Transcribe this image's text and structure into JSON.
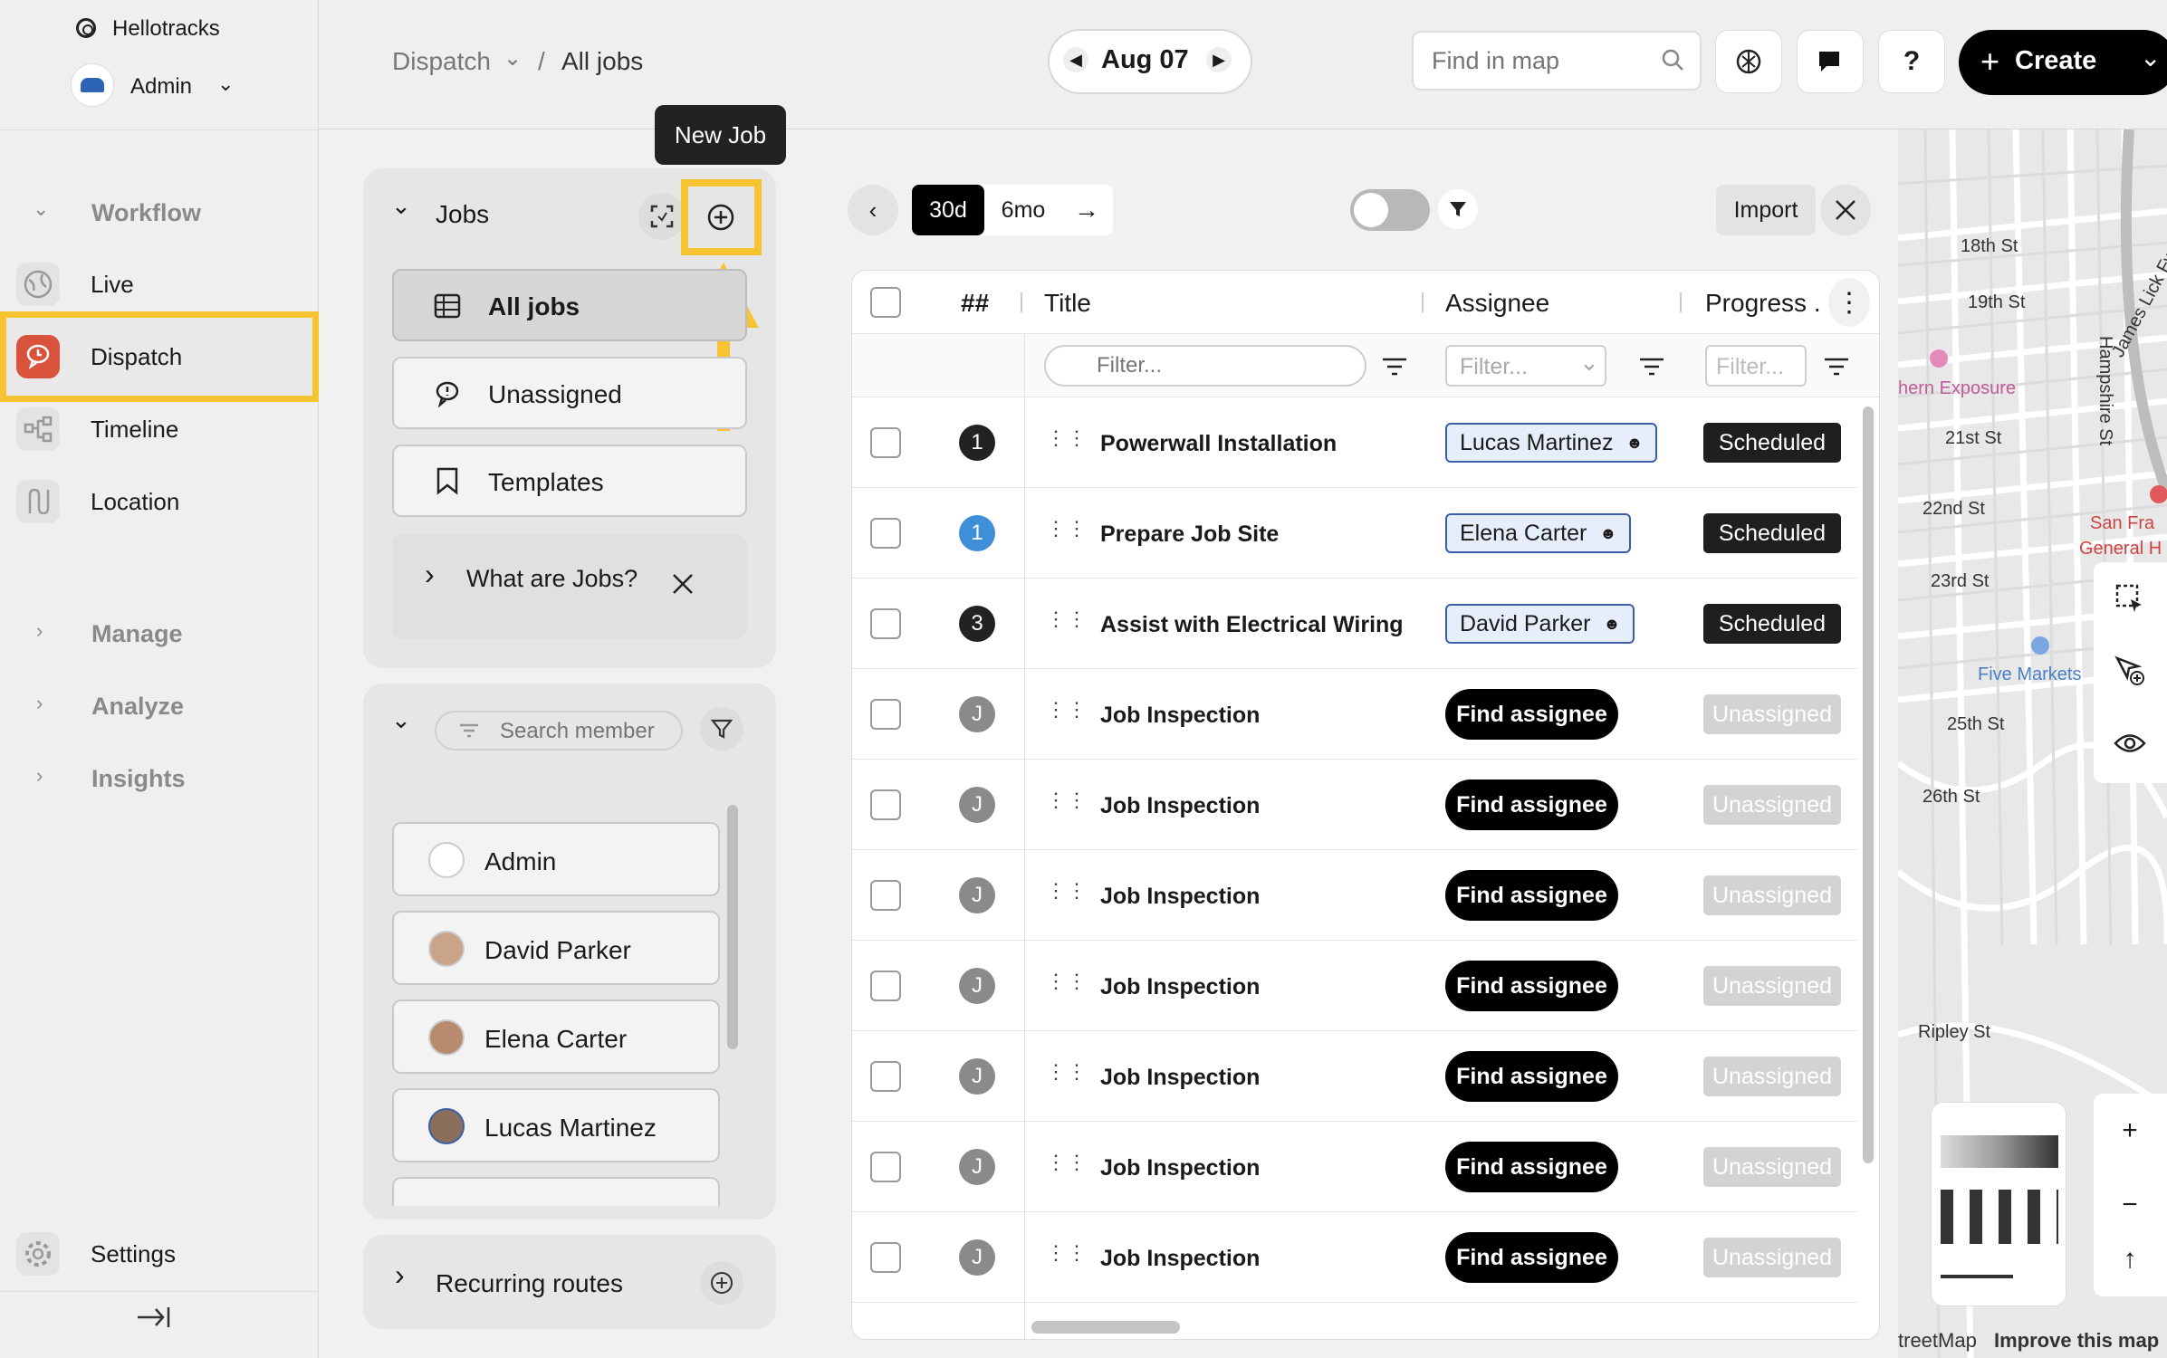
{
  "app": {
    "brand": "Hellotracks",
    "user": "Admin"
  },
  "nav": {
    "workflow": "Workflow",
    "items": [
      {
        "label": "Live",
        "icon": "globe-icon"
      },
      {
        "label": "Dispatch",
        "icon": "dispatch-icon"
      },
      {
        "label": "Timeline",
        "icon": "timeline-icon"
      },
      {
        "label": "Location",
        "icon": "location-icon"
      }
    ],
    "manage": "Manage",
    "analyze": "Analyze",
    "insights": "Insights",
    "settings": "Settings"
  },
  "topbar": {
    "crumb_root": "Dispatch",
    "crumb_sep": "/",
    "crumb_current": "All jobs",
    "date": "Aug 07",
    "map_search_placeholder": "Find in map",
    "help": "?",
    "create": "Create"
  },
  "tooltip": "New Job",
  "jobs_panel": {
    "title": "Jobs",
    "views": [
      "All jobs",
      "Unassigned",
      "Templates"
    ],
    "info": "What are Jobs?",
    "search_member_placeholder": "Search member",
    "members": [
      "Admin",
      "David Parker",
      "Elena Carter",
      "Lucas Martinez"
    ],
    "recurring": "Recurring routes"
  },
  "toolbar": {
    "range_30d": "30d",
    "range_6mo": "6mo",
    "import": "Import"
  },
  "table": {
    "headers": {
      "num": "##",
      "title": "Title",
      "assignee": "Assignee",
      "progress": "Progress ."
    },
    "filter_placeholder": "Filter...",
    "find_assignee": "Find assignee",
    "rows": [
      {
        "num": "1",
        "num_style": "dark",
        "title": "Powerwall Installation",
        "assignee": "Lucas Martinez",
        "status": "Scheduled"
      },
      {
        "num": "1",
        "num_style": "blue",
        "title": "Prepare Job Site",
        "assignee": "Elena Carter",
        "status": "Scheduled"
      },
      {
        "num": "3",
        "num_style": "dark",
        "title": "Assist with Electrical Wiring",
        "assignee": "David Parker",
        "status": "Scheduled"
      },
      {
        "num": "J",
        "num_style": "gray",
        "title": "Job Inspection",
        "assignee": "",
        "status": "Unassigned"
      },
      {
        "num": "J",
        "num_style": "gray",
        "title": "Job Inspection",
        "assignee": "",
        "status": "Unassigned"
      },
      {
        "num": "J",
        "num_style": "gray",
        "title": "Job Inspection",
        "assignee": "",
        "status": "Unassigned"
      },
      {
        "num": "J",
        "num_style": "gray",
        "title": "Job Inspection",
        "assignee": "",
        "status": "Unassigned"
      },
      {
        "num": "J",
        "num_style": "gray",
        "title": "Job Inspection",
        "assignee": "",
        "status": "Unassigned"
      },
      {
        "num": "J",
        "num_style": "gray",
        "title": "Job Inspection",
        "assignee": "",
        "status": "Unassigned"
      },
      {
        "num": "J",
        "num_style": "gray",
        "title": "Job Inspection",
        "assignee": "",
        "status": "Unassigned"
      }
    ]
  },
  "map": {
    "streets": [
      "18th St",
      "19th St",
      "21st St",
      "22nd St",
      "23rd St",
      "25th St",
      "26th St",
      "Ripley St",
      "Hampshire St",
      "James Lick Fwy"
    ],
    "places": [
      "hern Exposure",
      "San Fra",
      "General H",
      "Five Markets"
    ],
    "footer_left": "treetMap",
    "footer_right": "Improve this map"
  },
  "colors": {
    "highlight": "#f6c431",
    "dispatch_icon": "#d9533c",
    "assignee_border": "#3a5fa8",
    "blue_num": "#3f8fd8"
  }
}
